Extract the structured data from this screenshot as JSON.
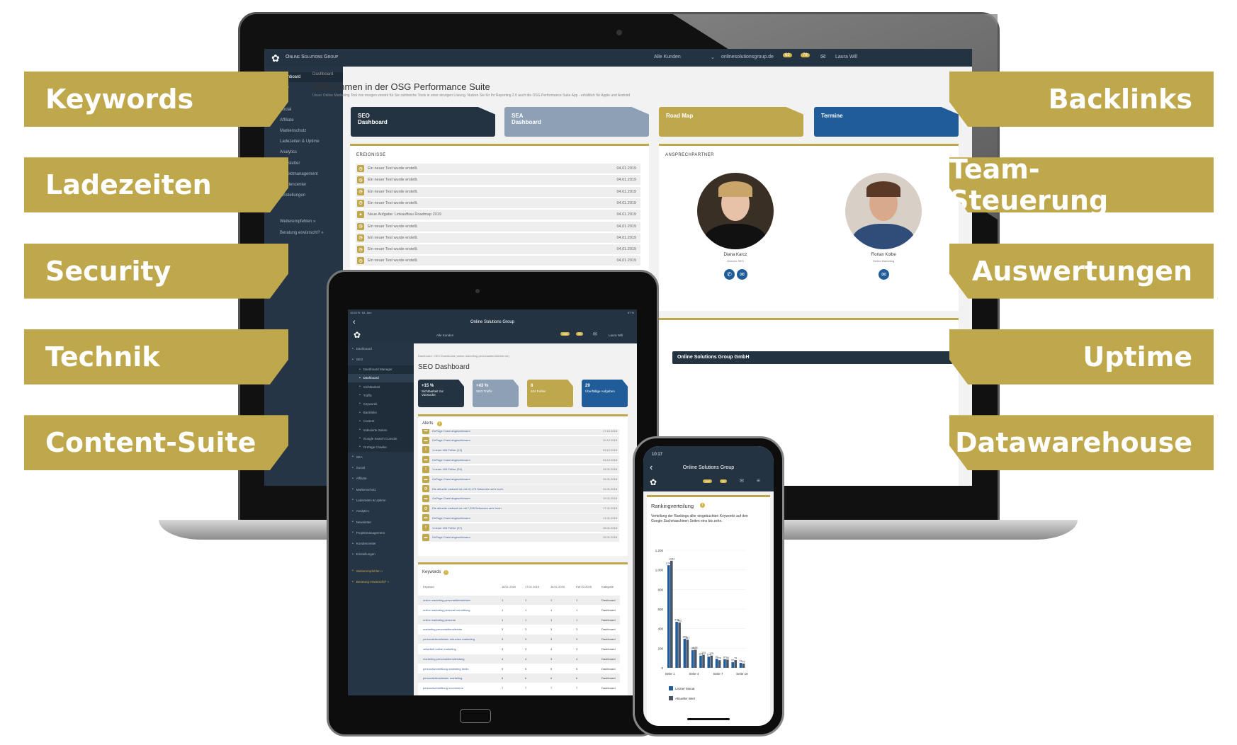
{
  "colors": {
    "gold": "#bfa74c",
    "navy": "#243342",
    "slate": "#8ea0b6",
    "blue": "#1f5c99"
  },
  "feature_labels": {
    "left": [
      "Keywords",
      "Ladezeiten",
      "Security",
      "Technik",
      "Content-Suite"
    ],
    "right": [
      "Backlinks",
      "Team-Steuerung",
      "Auswertungen",
      "Uptime",
      "Datawarehouse"
    ]
  },
  "laptop": {
    "brand": "Online Solutions Group",
    "topbar": {
      "client": "Alle Kunden",
      "domain": "onlinesolutionsgroup.de",
      "badge1": "62",
      "badge2": "78",
      "user": "Laura Will"
    },
    "sidebar": [
      "Dashboard",
      "SEO",
      "SEA",
      "Social",
      "Affiliate",
      "Markenschutz",
      "Ladezeiten & Uptime",
      "Analytics",
      "Newsletter",
      "Projektmanagement",
      "Kundencenter",
      "Einstellungen",
      "Weiterempfehlen »",
      "Beratung erwünscht? »"
    ],
    "breadcrumb": "Dashboard",
    "title": "Willkommen in der OSG Performance Suite",
    "subtitle": "Unser Online Marketing Tool von morgen vereint für Sie zahlreiche Tools in einer einzigen Lösung. Nutzen Sie für Ihr Reporting 2.0 auch die OSG Performance Suite App - erhältlich für Apple und Android",
    "tiles": [
      {
        "label": "SEO\nDashboard",
        "color": "#243342"
      },
      {
        "label": "SEA\nDashboard",
        "color": "#8ea0b6"
      },
      {
        "label": "Road Map",
        "color": "#bfa74c"
      },
      {
        "label": "Termine",
        "color": "#1f5c99"
      }
    ],
    "events": {
      "title": "EREIGNISSE",
      "rows": [
        {
          "text": "Ein neuer Test wurde erstellt.",
          "date": "04.01.2019"
        },
        {
          "text": "Ein neuer Test wurde erstellt.",
          "date": "04.01.2019"
        },
        {
          "text": "Ein neuer Test wurde erstellt.",
          "date": "04.01.2019"
        },
        {
          "text": "Ein neuer Test wurde erstellt.",
          "date": "04.01.2019"
        },
        {
          "text": "Neue Aufgabe: Linkaufbau Roadmap 2019",
          "date": "04.01.2019"
        },
        {
          "text": "Ein neuer Test wurde erstellt.",
          "date": "04.01.2019"
        },
        {
          "text": "Ein neuer Test wurde erstellt.",
          "date": "04.01.2019"
        },
        {
          "text": "Ein neuer Test wurde erstellt.",
          "date": "04.01.2019"
        },
        {
          "text": "Ein neuer Test wurde erstellt.",
          "date": "04.01.2019"
        }
      ]
    },
    "contacts": {
      "title": "ANSPRECHPARTNER",
      "people": [
        {
          "name": "Diana Karcz",
          "role": "Director SEO"
        },
        {
          "name": "Florian Kolbe",
          "role": "Online Marketing"
        }
      ]
    },
    "footer_bar": "Online Solutions Group GmbH"
  },
  "tablet": {
    "status_time": "11:04  Fr. 18. Jan.",
    "status_right": "67 %",
    "app_title": "Online Solutions Group",
    "topbar": {
      "client": "Alle Kunden",
      "badge1": "268",
      "badge2": "90",
      "user": "Laura Will"
    },
    "sidebar": [
      {
        "label": "Dashboard",
        "sub": false
      },
      {
        "label": "SEO",
        "sub": false
      },
      {
        "label": "Dashboard Manager",
        "sub": true
      },
      {
        "label": "Dashboard",
        "sub": true,
        "active": true
      },
      {
        "label": "Sichtbarkeit",
        "sub": true
      },
      {
        "label": "Traffic",
        "sub": true
      },
      {
        "label": "Keywords",
        "sub": true
      },
      {
        "label": "Backlinks",
        "sub": true
      },
      {
        "label": "Content",
        "sub": true
      },
      {
        "label": "Indexierte Seiten",
        "sub": true
      },
      {
        "label": "Google Search Console",
        "sub": true
      },
      {
        "label": "OnPage Crawler",
        "sub": true
      },
      {
        "label": "SEA",
        "sub": false
      },
      {
        "label": "Social",
        "sub": false
      },
      {
        "label": "Affiliate",
        "sub": false
      },
      {
        "label": "Markenschutz",
        "sub": false
      },
      {
        "label": "Ladezeiten & Uptime",
        "sub": false
      },
      {
        "label": "Analytics",
        "sub": false
      },
      {
        "label": "Newsletter",
        "sub": false
      },
      {
        "label": "Projektmanagement",
        "sub": false
      },
      {
        "label": "Kundencenter",
        "sub": false
      },
      {
        "label": "Einstellungen",
        "sub": false
      },
      {
        "label": "Weiterempfehlen »",
        "sub": false
      },
      {
        "label": "Beratung erwünscht? »",
        "sub": false
      }
    ],
    "breadcrumb": "Dashboard › SEO Dashboard (online-marketing-personaldienstleister.de)",
    "title": "SEO Dashboard",
    "tiles": [
      {
        "value": "+15 %",
        "label": "Sichtbarkeit zur Vorwoche",
        "color": "#243342"
      },
      {
        "value": "+43 %",
        "label": "SEO Traffic",
        "color": "#8ea0b6"
      },
      {
        "value": "8",
        "label": "404 Fehler",
        "color": "#bfa74c"
      },
      {
        "value": "29",
        "label": "Überfällige Aufgaben",
        "color": "#1f5c99"
      }
    ],
    "alerts": {
      "title": "Alerts",
      "rows": [
        {
          "icon": "folder",
          "text": "OnPage Crawl abgeschlossen",
          "date": "17.12.2018"
        },
        {
          "icon": "folder",
          "text": "OnPage Crawl abgeschlossen",
          "date": "10.12.2018"
        },
        {
          "icon": "alert",
          "text": "1 neuer 404 Fehler (13)",
          "date": "03.12.2018"
        },
        {
          "icon": "folder",
          "text": "OnPage Crawl abgeschlossen",
          "date": "03.12.2018"
        },
        {
          "icon": "alert",
          "text": "1 neuer 404 Fehler (24)",
          "date": "26.11.2018"
        },
        {
          "icon": "folder",
          "text": "OnPage Crawl abgeschlossen",
          "date": "26.11.2018"
        },
        {
          "icon": "clock",
          "text": "Die aktuelle Ladezeit ist mit 10,173 Sekunden sehr hoch.",
          "date": "24.11.2018"
        },
        {
          "icon": "folder",
          "text": "OnPage Crawl abgeschlossen",
          "date": "19.11.2018"
        },
        {
          "icon": "clock",
          "text": "Die aktuelle Ladezeit ist mit 7,028 Sekunden sehr hoch.",
          "date": "17.11.2018"
        },
        {
          "icon": "folder",
          "text": "OnPage Crawl abgeschlossen",
          "date": "12.11.2018"
        },
        {
          "icon": "alert",
          "text": "1 neuer 404 Fehler (37)",
          "date": "08.11.2018"
        },
        {
          "icon": "folder",
          "text": "OnPage Crawl abgeschlossen",
          "date": "05.11.2018"
        }
      ]
    },
    "keywords": {
      "title": "Keywords",
      "columns": [
        "Keyword",
        "18.01 2019",
        "17.01 2019",
        "16.01 2019",
        "KW 03 2019",
        "Kategorie"
      ],
      "rows": [
        [
          "online marketing personaldienstleister",
          "1",
          "1",
          "1",
          "1",
          "Dashboard"
        ],
        [
          "online marketing personal vermittlung",
          "1",
          "1",
          "1",
          "1",
          "Dashboard"
        ],
        [
          "online marketing personal",
          "1",
          "1",
          "1",
          "1",
          "Dashboard"
        ],
        [
          "marketing personaldienstleister",
          "3",
          "3",
          "3",
          "3",
          "Dashboard"
        ],
        [
          "personaldienstleister münchen marketing",
          "3",
          "3",
          "3",
          "3",
          "Dashboard"
        ],
        [
          "zeitarbeit online marketing",
          "3",
          "3",
          "4",
          "3",
          "Dashboard"
        ],
        [
          "marketing personaldienstleistung",
          "4",
          "4",
          "3",
          "4",
          "Dashboard"
        ],
        [
          "personalvermittlung marketing berlin",
          "5",
          "5",
          "5",
          "5",
          "Dashboard"
        ],
        [
          "personaldienstleister marketing",
          "6",
          "6",
          "6",
          "6",
          "Dashboard"
        ],
        [
          "personalvermittlung ecommerce",
          "7",
          "7",
          "7",
          "7",
          "Dashboard"
        ]
      ]
    }
  },
  "phone": {
    "status_time": "10:17",
    "app_title": "Online Solutions Group",
    "badge1": "199",
    "badge2": "30",
    "card_title": "Rankingverteilung",
    "card_text": "Verteilung der Rankings aller eingebuchten Keywords auf den Google Suchmaschinen Seiten eins bis zehn."
  },
  "chart_data": {
    "type": "bar",
    "categories": [
      "Seite 1",
      "Seite 2",
      "Seite 3",
      "Seite 4",
      "Seite 5",
      "Seite 6",
      "Seite 7",
      "Seite 8",
      "Seite 9",
      "Seite 10"
    ],
    "tick_labels_x": [
      "Seite 1",
      "Seite 4",
      "Seite 7",
      "Seite 10"
    ],
    "series": [
      {
        "name": "Letzter Monat",
        "color": "#1f5c99",
        "values": [
          1047,
          470,
          296,
          180,
          124,
          114,
          92,
          87,
          57,
          51
        ]
      },
      {
        "name": "Aktueller Wert",
        "color": "#4a5566",
        "values": [
          1093,
          462,
          287,
          185,
          133,
          125,
          78,
          84,
          79,
          43
        ]
      }
    ],
    "ylim": [
      0,
      1200
    ],
    "yticks": [
      0,
      200,
      400,
      600,
      800,
      1000,
      1200
    ],
    "ytick_labels": [
      "0",
      "200",
      "400",
      "600",
      "800",
      "1,000",
      "1,200"
    ],
    "legend": "bottom"
  }
}
